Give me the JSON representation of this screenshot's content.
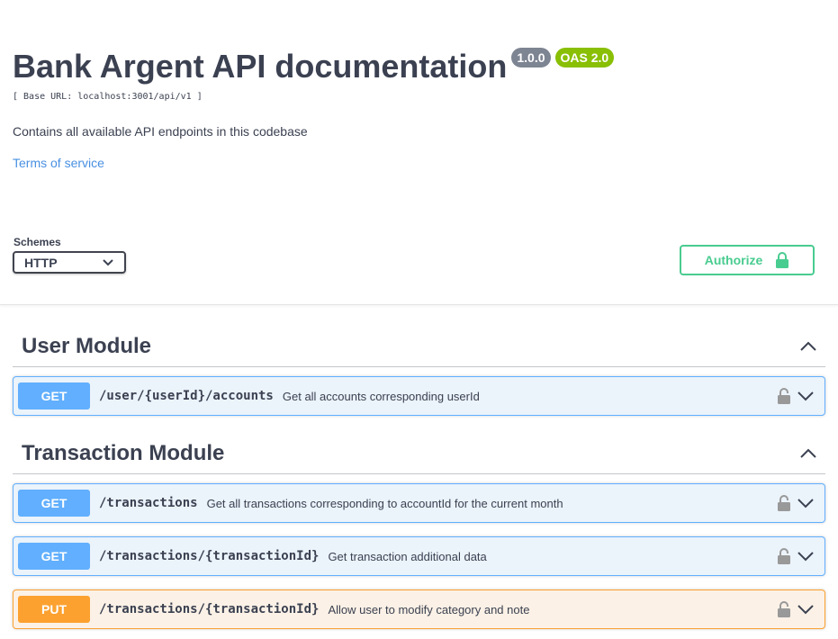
{
  "info": {
    "title": "Bank Argent API documentation",
    "version": "1.0.0",
    "oas": "OAS 2.0",
    "base_url": "[ Base URL: localhost:3001/api/v1 ]",
    "description": "Contains all available API endpoints in this codebase",
    "terms": "Terms of service"
  },
  "schemes": {
    "label": "Schemes",
    "selected": "HTTP"
  },
  "authorize": {
    "label": "Authorize"
  },
  "modules": [
    {
      "title": "User Module",
      "operations": [
        {
          "method": "GET",
          "path": "/user/{userId}/accounts",
          "summary": "Get all accounts corresponding userId"
        }
      ]
    },
    {
      "title": "Transaction Module",
      "operations": [
        {
          "method": "GET",
          "path": "/transactions",
          "summary": "Get all transactions corresponding to accountId for the current month"
        },
        {
          "method": "GET",
          "path": "/transactions/{transactionId}",
          "summary": "Get transaction additional data"
        },
        {
          "method": "PUT",
          "path": "/transactions/{transactionId}",
          "summary": "Allow user to modify category and note"
        }
      ]
    }
  ],
  "colors": {
    "get": "#61affe",
    "put": "#fca130",
    "authorize": "#49cc90",
    "version_badge": "#7d8492",
    "oas_badge": "#89bf04"
  },
  "icons": {
    "lock": "lock-icon",
    "chevron_down": "chevron-down-icon",
    "chevron_up": "chevron-up-icon"
  }
}
